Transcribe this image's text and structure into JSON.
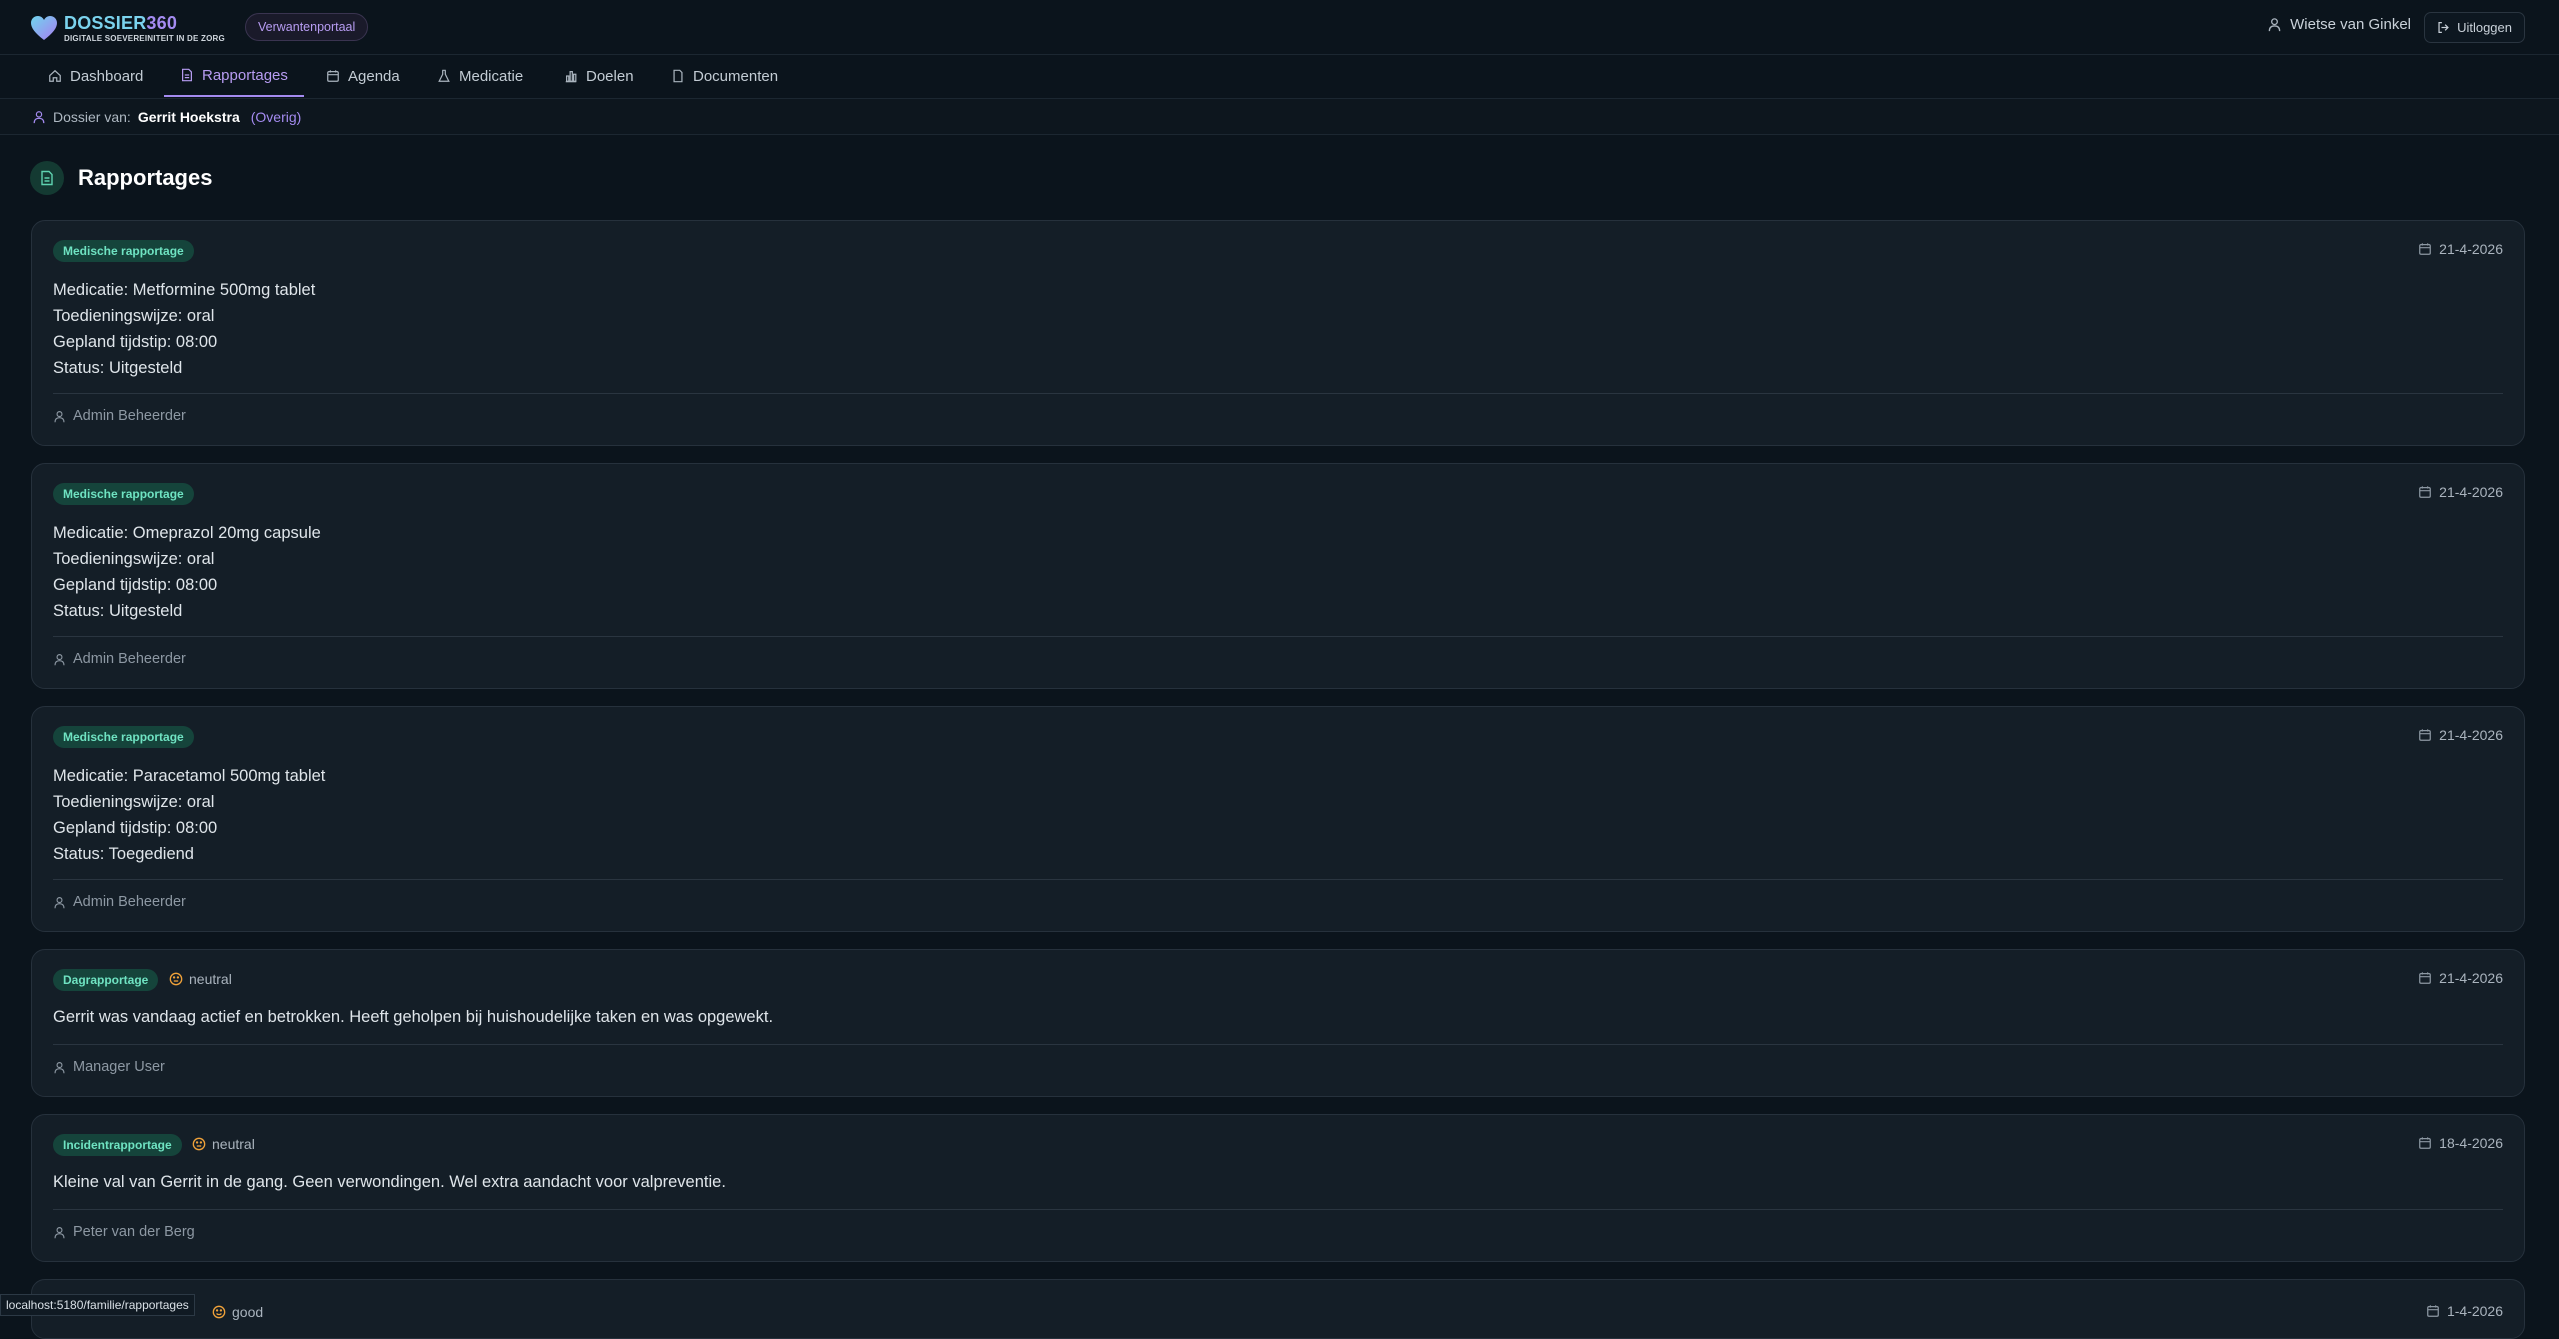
{
  "header": {
    "brand_part1": "DOSSIER",
    "brand_part2": "360",
    "tagline": "DIGITALE SOEVEREINITEIT IN DE ZORG",
    "portal_badge": "Verwantenportaal",
    "user_name": "Wietse van Ginkel",
    "logout_label": "Uitloggen"
  },
  "nav": {
    "tabs": [
      {
        "label": "Dashboard",
        "icon": "home-icon"
      },
      {
        "label": "Rapportages",
        "icon": "document-icon",
        "active": true
      },
      {
        "label": "Agenda",
        "icon": "calendar-icon"
      },
      {
        "label": "Medicatie",
        "icon": "flask-icon"
      },
      {
        "label": "Doelen",
        "icon": "bar-chart-icon"
      },
      {
        "label": "Documenten",
        "icon": "file-icon"
      }
    ]
  },
  "dossier": {
    "prefix": "Dossier van:",
    "name": "Gerrit Hoekstra",
    "category": "(Overig)"
  },
  "page": {
    "title": "Rapportages"
  },
  "reports": [
    {
      "type": "Medische rapportage",
      "date": "21-4-2026",
      "lines": [
        "Medicatie: Metformine 500mg tablet",
        "Toedieningswijze: oral",
        "Gepland tijdstip: 08:00",
        "Status: Uitgesteld"
      ],
      "author": "Admin Beheerder"
    },
    {
      "type": "Medische rapportage",
      "date": "21-4-2026",
      "lines": [
        "Medicatie: Omeprazol 20mg capsule",
        "Toedieningswijze: oral",
        "Gepland tijdstip: 08:00",
        "Status: Uitgesteld"
      ],
      "author": "Admin Beheerder"
    },
    {
      "type": "Medische rapportage",
      "date": "21-4-2026",
      "lines": [
        "Medicatie: Paracetamol 500mg tablet",
        "Toedieningswijze: oral",
        "Gepland tijdstip: 08:00",
        "Status: Toegediend"
      ],
      "author": "Admin Beheerder"
    },
    {
      "type": "Dagrapportage",
      "mood": "neutral",
      "date": "21-4-2026",
      "text": "Gerrit was vandaag actief en betrokken. Heeft geholpen bij huishoudelijke taken en was opgewekt.",
      "author": "Manager User"
    },
    {
      "type": "Incidentrapportage",
      "mood": "neutral",
      "date": "18-4-2026",
      "text": "Kleine val van Gerrit in de gang. Geen verwondingen. Wel extra aandacht voor valpreventie.",
      "author": "Peter van der Berg"
    },
    {
      "mood": "good",
      "date": "1-4-2026"
    }
  ],
  "status_bar": {
    "url": "localhost:5180/familie/rapportages"
  },
  "colors": {
    "background": "#0b141c",
    "card": "#141e27",
    "accent_purple": "#a48bf0",
    "badge_green_bg": "#15443b",
    "badge_green_text": "#6fe3c2",
    "mood_orange": "#f0a23a"
  }
}
